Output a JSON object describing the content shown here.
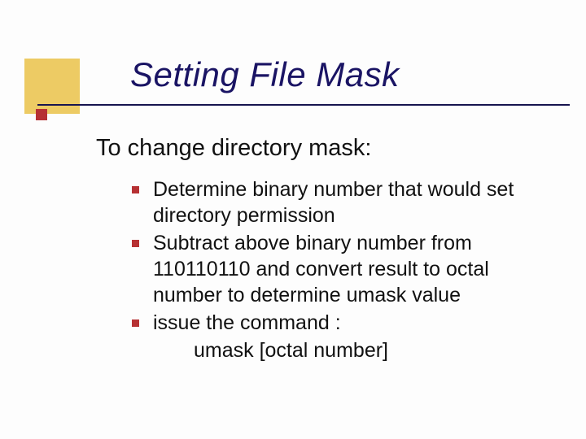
{
  "title": "Setting File Mask",
  "heading": "To change directory mask:",
  "bullets": [
    "Determine binary number that would set directory permission",
    "Subtract above binary number from 110110110 and convert result to octal number to determine umask value",
    "issue the command :"
  ],
  "command_line": "umask [octal number]"
}
